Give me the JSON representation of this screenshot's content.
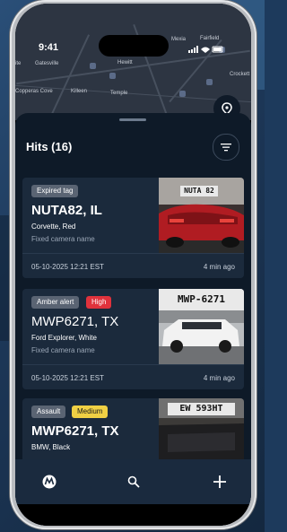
{
  "status_bar": {
    "time": "9:41"
  },
  "map": {
    "labels": {
      "mexia": "Mexia",
      "fairfield": "Fairfield",
      "gatesville": "Gatesville",
      "hewitt": "Hewitt",
      "crockett": "Crockett",
      "copperas_cove": "Copperas Cove",
      "killeen": "Killeen",
      "temple": "Temple",
      "ite": "ite"
    }
  },
  "header": {
    "title": "Hits (16)"
  },
  "hits": [
    {
      "tags": [
        {
          "label": "Expired tag",
          "style": "grey"
        }
      ],
      "plate": "NUTA82, IL",
      "vehicle": "Corvette, Red",
      "camera": "Fixed camera name",
      "date": "05-10-2025 12:21 EST",
      "ago": "4 min ago",
      "plate_photo_text": "NUTA 82"
    },
    {
      "tags": [
        {
          "label": "Amber alert",
          "style": "grey"
        },
        {
          "label": "High",
          "style": "red"
        }
      ],
      "plate": "MWP6271, TX",
      "vehicle": "Ford Explorer, White",
      "camera": "Fixed camera name",
      "date": "05-10-2025 12:21 EST",
      "ago": "4 min ago",
      "plate_photo_text": "MWP-6271"
    },
    {
      "tags": [
        {
          "label": "Assault",
          "style": "grey"
        },
        {
          "label": "Medium",
          "style": "yellow"
        }
      ],
      "plate": "MWP6271, TX",
      "vehicle": "BMW, Black",
      "camera": "",
      "date": "",
      "ago": "",
      "plate_photo_text": "EW 593HT"
    }
  ],
  "colors": {
    "accent_red": "#e0323c",
    "accent_yellow": "#f0d044",
    "sheet_bg": "#0e1a28",
    "card_bg": "#1b2a3c"
  },
  "nav": {
    "items": [
      "motorola-logo-icon",
      "search-icon",
      "plus-icon"
    ]
  }
}
